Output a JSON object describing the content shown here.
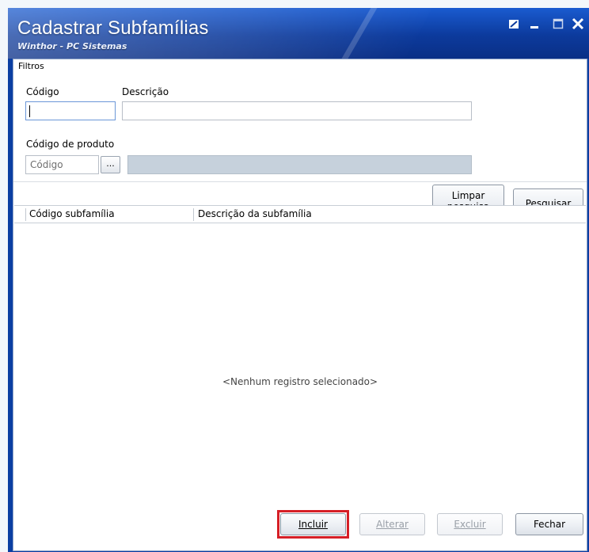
{
  "window": {
    "title": "Cadastrar Subfamílias",
    "subtitle": "Winthor - PC Sistemas"
  },
  "filtros": {
    "legend": "Filtros",
    "codigo_label": "Código",
    "codigo_value": "",
    "descricao_label": "Descrição",
    "descricao_value": "",
    "codigo_produto_label": "Código de produto",
    "codigo_produto_placeholder": "Código",
    "browse_label": "...",
    "limpar_label": "Limpar pesquisa",
    "pesquisar_label": "Pesquisar"
  },
  "grid": {
    "columns": [
      "Código subfamília",
      "Descrição da subfamília"
    ],
    "empty_message": "<Nenhum registro selecionado>"
  },
  "actions": {
    "incluir_label": "Incluir",
    "alterar_label": "Alterar",
    "excluir_label": "Excluir",
    "fechar_label": "Fechar"
  },
  "colors": {
    "titlebar": "#0c3a9c",
    "highlight": "#d61f26",
    "disabled_text": "#9aa0a8"
  },
  "icons": {
    "restore": "restore-icon",
    "minimize": "minimize-icon",
    "maximize": "maximize-icon",
    "close": "close-icon"
  }
}
